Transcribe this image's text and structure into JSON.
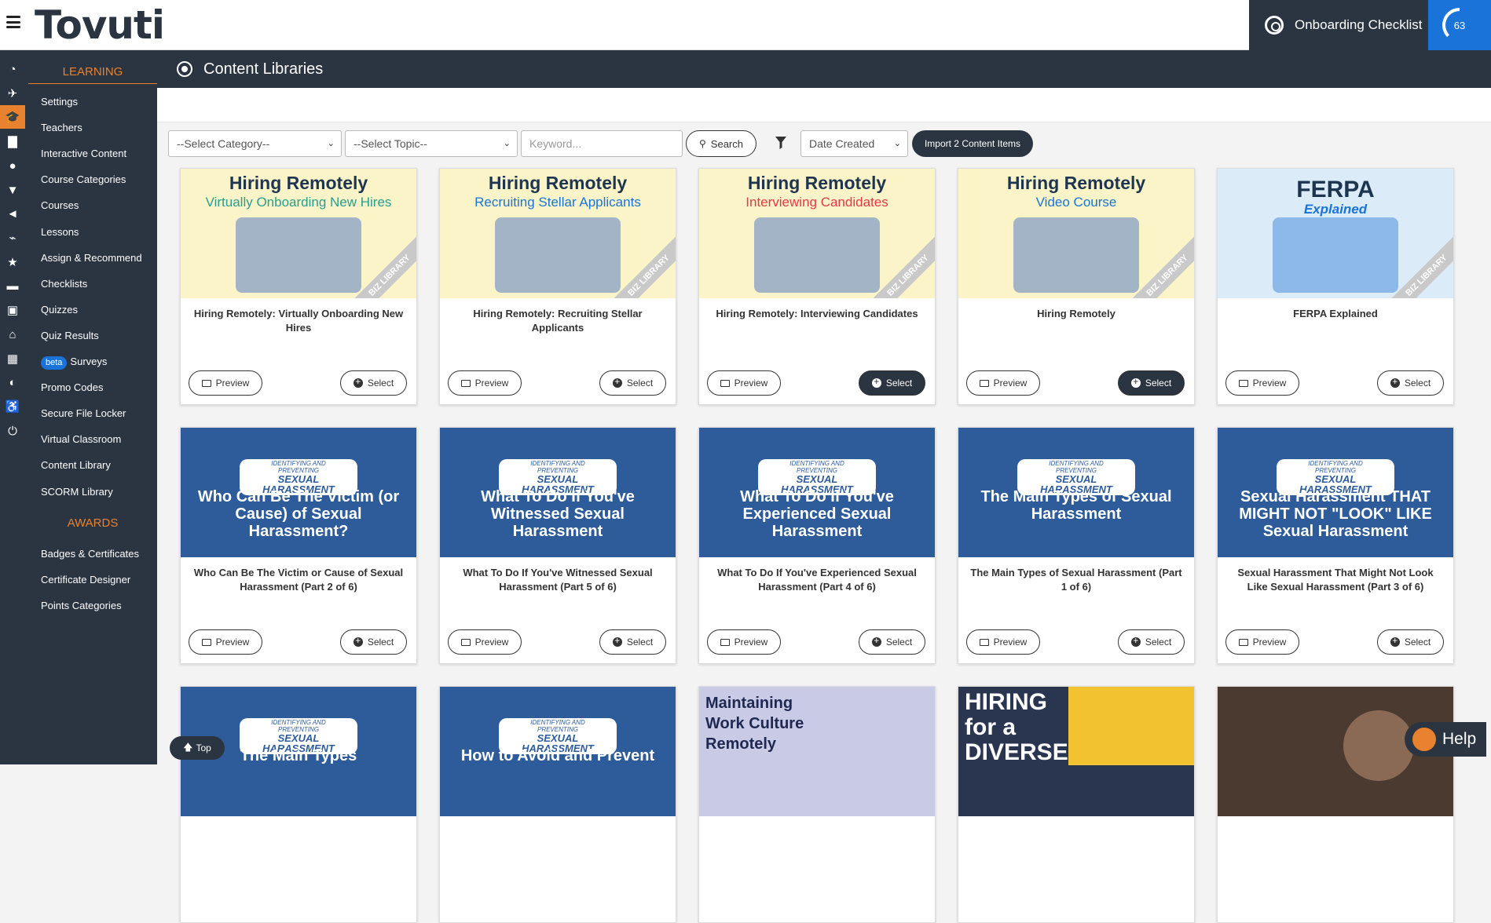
{
  "app": {
    "logo": "Tovuti"
  },
  "topbar": {
    "onboarding_label": "Onboarding Checklist",
    "progress_value": "63"
  },
  "sidebar": {
    "learning_header": "LEARNING",
    "learning_items": [
      "Settings",
      "Teachers",
      "Interactive Content",
      "Course Categories",
      "Courses",
      "Lessons",
      "Assign & Recommend",
      "Checklists",
      "Quizzes",
      "Quiz Results",
      "Surveys",
      "Promo Codes",
      "Secure File Locker",
      "Virtual Classroom",
      "Content Library",
      "SCORM Library"
    ],
    "beta_badge": "beta",
    "awards_header": "AWARDS",
    "awards_items": [
      "Badges & Certificates",
      "Certificate Designer",
      "Points Categories"
    ]
  },
  "page": {
    "title": "Content Libraries"
  },
  "filters": {
    "category": "--Select Category--",
    "topic": "--Select Topic--",
    "keyword_placeholder": "Keyword...",
    "search_label": "Search",
    "sort": "Date Created",
    "import_label": "Import 2 Content Items"
  },
  "buttons": {
    "preview": "Preview",
    "select": "Select"
  },
  "cards": [
    {
      "title": "Hiring Remotely: Virtually Onboarding New Hires",
      "thumb_h1": "Hiring Remotely",
      "thumb_h2": "Virtually Onboarding New Hires",
      "h2_color": "#2a9d8f",
      "selected": false
    },
    {
      "title": "Hiring Remotely: Recruiting Stellar Applicants",
      "thumb_h1": "Hiring Remotely",
      "thumb_h2": "Recruiting Stellar Applicants",
      "h2_color": "#1a73d9",
      "selected": false
    },
    {
      "title": "Hiring Remotely: Interviewing Candidates",
      "thumb_h1": "Hiring Remotely",
      "thumb_h2": "Interviewing Candidates",
      "h2_color": "#e63946",
      "selected": true
    },
    {
      "title": "Hiring Remotely",
      "thumb_h1": "Hiring Remotely",
      "thumb_h2": "Video Course",
      "h2_color": "#1a73d9",
      "selected": true
    },
    {
      "title": "FERPA Explained",
      "thumb_h1": "FERPA",
      "thumb_h2": "Explained",
      "h2_color": "#1a73d9",
      "selected": false
    },
    {
      "title": "Who Can Be The Victim or Cause of Sexual Harassment (Part 2 of 6)",
      "pill_small": "IDENTIFYING AND PREVENTING",
      "pill_big": "SEXUAL HARASSMENT",
      "thumb_text": "Who Can Be The Victim (or Cause) of Sexual Harassment?",
      "selected": false
    },
    {
      "title": "What To Do If You've Witnessed Sexual Harassment (Part 5 of 6)",
      "pill_small": "IDENTIFYING AND PREVENTING",
      "pill_big": "SEXUAL HARASSMENT",
      "thumb_text": "What To Do If You've Witnessed Sexual Harassment",
      "selected": false
    },
    {
      "title": "What To Do If You've Experienced Sexual Harassment (Part 4 of 6)",
      "pill_small": "IDENTIFYING AND PREVENTING",
      "pill_big": "SEXUAL HARASSMENT",
      "thumb_text": "What To Do If You've Experienced Sexual Harassment",
      "selected": false
    },
    {
      "title": "The Main Types of Sexual Harassment (Part 1 of 6)",
      "pill_small": "IDENTIFYING AND PREVENTING",
      "pill_big": "SEXUAL HARASSMENT",
      "thumb_text": "The Main Types of Sexual Harassment",
      "selected": false
    },
    {
      "title": "Sexual Harassment That Might Not Look Like Sexual Harassment (Part 3 of 6)",
      "pill_small": "IDENTIFYING AND PREVENTING",
      "pill_big": "SEXUAL HARASSMENT",
      "thumb_text": "Sexual Harassment THAT MIGHT NOT \"LOOK\" LIKE Sexual Harassment",
      "selected": false
    },
    {
      "pill_small": "IDENTIFYING AND PREVENTING",
      "pill_big": "SEXUAL HARASSMENT",
      "thumb_text": "The Main Types"
    },
    {
      "pill_small": "IDENTIFYING AND PREVENTING",
      "pill_big": "SEXUAL HARASSMENT",
      "thumb_text": "How to Avoid and Prevent"
    },
    {
      "thumb_text": "Maintaining Work Culture Remotely"
    },
    {
      "thumb_text": "HIRING for a DIVERSE"
    },
    {
      "thumb_text": ""
    }
  ],
  "float": {
    "top_label": "Top",
    "help_label": "Help"
  },
  "colors": {
    "accent": "#e8822e",
    "nav_bg": "#2b3441",
    "blue": "#1a73d9"
  }
}
